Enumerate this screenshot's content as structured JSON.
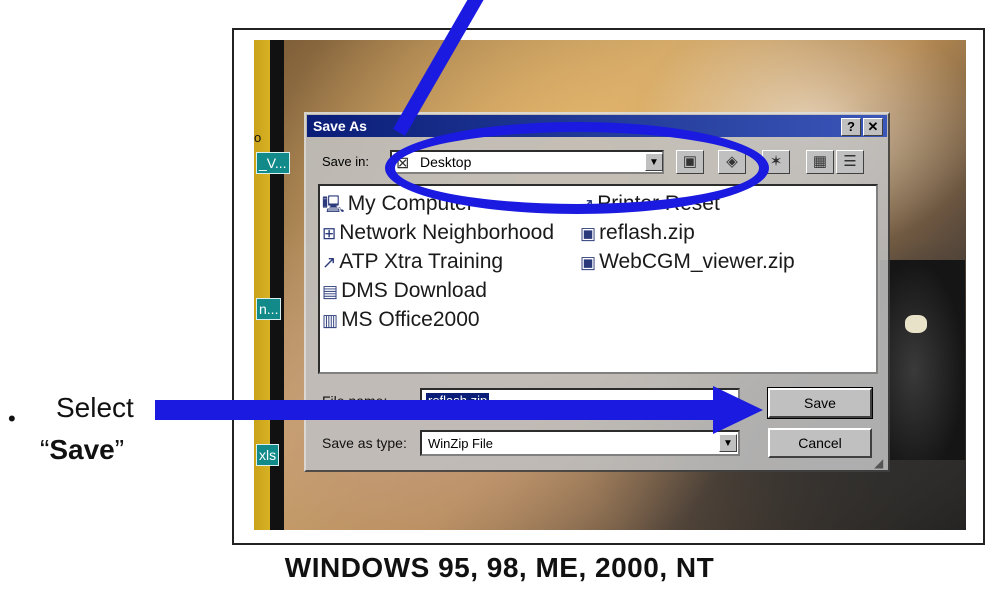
{
  "slide": {
    "bullet": "•",
    "line1": "Select",
    "line2_open_quote": "“",
    "line2_bold": "Save",
    "line2_close_quote": "”",
    "caption": "WINDOWS 95, 98, ME, 2000, NT"
  },
  "desktop_tags": [
    "o",
    "_V...",
    "n...",
    "xls"
  ],
  "dialog": {
    "title": "Save As",
    "help_label": "?",
    "close_label": "✕",
    "look_in_label": "Save in:",
    "look_in_value": "Desktop",
    "files_col1": [
      {
        "icon": "computer-icon",
        "name": "My Computer"
      },
      {
        "icon": "network-icon",
        "name": "Network Neighborhood"
      },
      {
        "icon": "shortcut-icon",
        "name": "ATP Xtra Training"
      },
      {
        "icon": "folder-icon",
        "name": "DMS Download"
      },
      {
        "icon": "office-icon",
        "name": "MS Office2000"
      }
    ],
    "files_col2": [
      {
        "icon": "shortcut-icon",
        "name": "Printer Reset"
      },
      {
        "icon": "zip-icon",
        "name": "reflash.zip"
      },
      {
        "icon": "zip-icon",
        "name": "WebCGM_viewer.zip"
      }
    ],
    "file_name_label": "File name:",
    "file_name_value": "reflash.zip",
    "save_as_type_label": "Save as type:",
    "save_as_type_value": "WinZip File",
    "save_button": "Save",
    "cancel_button": "Cancel"
  },
  "colors": {
    "annotation_blue": "#1a1ae0",
    "titlebar": "#0a1e78"
  }
}
